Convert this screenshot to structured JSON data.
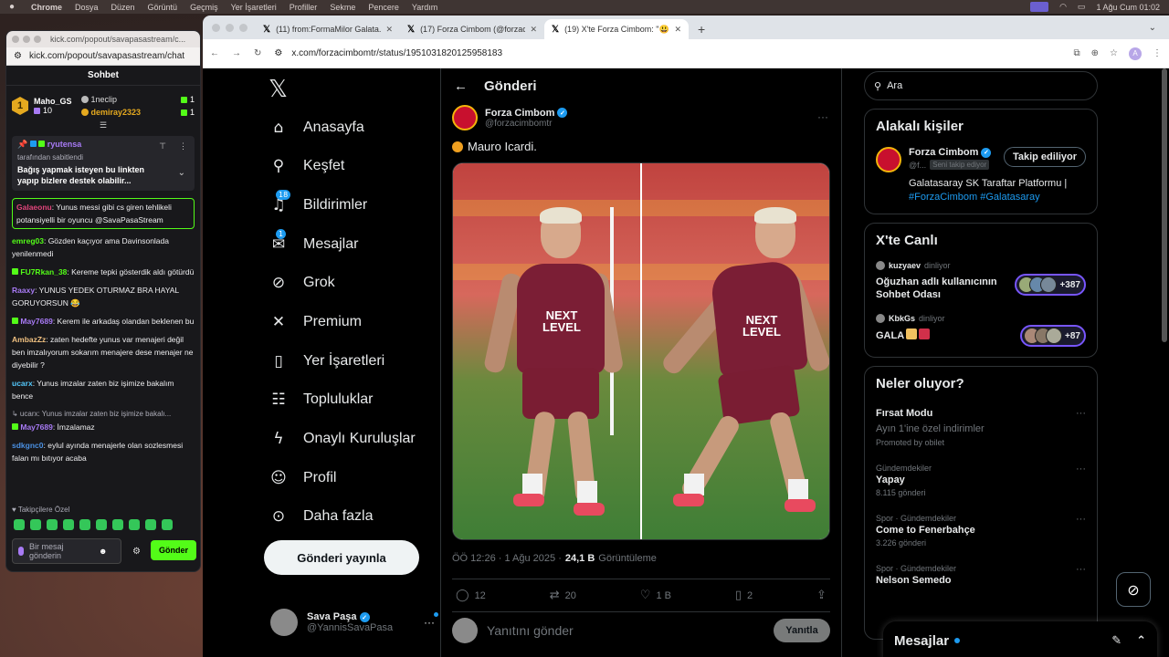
{
  "menubar": {
    "app": "Chrome",
    "items": [
      "Dosya",
      "Düzen",
      "Görüntü",
      "Geçmiş",
      "Yer İşaretleri",
      "Profiller",
      "Sekme",
      "Pencere",
      "Yardım"
    ],
    "clock": "1 Ağu Cum  01:02"
  },
  "kick": {
    "title_url": "kick.com/popout/savapasastream/c...",
    "url": "kick.com/popout/savapasastream/chat",
    "header": "Sohbet",
    "leader": {
      "name": "Maho_GS",
      "points": "10",
      "rank": "1"
    },
    "leader2": {
      "name": "1neclip",
      "points": "1"
    },
    "leader3": {
      "name": "demiray2323",
      "points": "1"
    },
    "pinned": {
      "user": "ryutensa",
      "subtitle": "tarafından sabitlendi",
      "message": "Bağış yapmak isteyen bu linkten yapıp bizlere destek olabilir..."
    },
    "messages": [
      {
        "user": "Galaeonu",
        "color": "#e0457b",
        "text": ": Yunus messi gibi cs giren tehlikeli potansiyelli bir oyuncu @SavaPasaStream",
        "highlight": true
      },
      {
        "user": "emreg03",
        "color": "#53fc18",
        "text": ": Gözden kaçıyor ama Davinsonlada yenilenmedi"
      },
      {
        "user": "FU7Rkan_38",
        "color": "#53fc18",
        "text": ": Kereme tepki gösterdik aldı götürdü",
        "badge": true
      },
      {
        "user": "Raaxy",
        "color": "#a77af4",
        "text": ": YUNUS YEDEK OTURMAZ BRA HAYAL GORUYORSUN 😂"
      },
      {
        "user": "May7689",
        "color": "#a77af4",
        "text": ": Kerem ile arkadaş olandan beklenen bu",
        "badge": true
      },
      {
        "user": "AmbazZz",
        "color": "#f0c080",
        "text": ": zaten hedefte yunus var menajeri değil ben imzalıyorum sokarım menajere dese menajer ne diyebilir ?"
      },
      {
        "user": "ucarx",
        "color": "#53c8fc",
        "text": ": Yunus imzalar zaten biz işimize bakalım bence"
      }
    ],
    "reply_ref": "↳ ucarx: Yunus imzalar zaten biz işimize bakalı...",
    "reply_msg": {
      "user": "May7689",
      "color": "#a77af4",
      "text": ": İmzalamaz"
    },
    "last_msg": {
      "user": "sdkgnc0",
      "color": "#4a90e2",
      "text": ": eylul ayında menajerle olan sozlesmesi falan mı bıtıyor acaba"
    },
    "emotes_label": "Takipçilere Özel",
    "input_placeholder": "Bir mesaj gönderin",
    "send": "Gönder"
  },
  "chrome": {
    "tabs": [
      {
        "title": "(11) from:FormaMilor Galata..."
      },
      {
        "title": "(17) Forza Cimbom (@forzaci..."
      },
      {
        "title": "(19) X'te Forza Cimbom: \"😃"
      }
    ],
    "url": "x.com/forzacimbomtr/status/1951031820125958183",
    "profile_letter": "A"
  },
  "nav": {
    "items": [
      {
        "label": "Anasayfa",
        "icon": "home-icon"
      },
      {
        "label": "Keşfet",
        "icon": "search-icon"
      },
      {
        "label": "Bildirimler",
        "icon": "bell-icon",
        "count": "18"
      },
      {
        "label": "Mesajlar",
        "icon": "mail-icon",
        "count": "1"
      },
      {
        "label": "Grok",
        "icon": "grok-icon"
      },
      {
        "label": "Premium",
        "icon": "x-icon"
      },
      {
        "label": "Yer İşaretleri",
        "icon": "bookmark-icon"
      },
      {
        "label": "Topluluklar",
        "icon": "people-icon"
      },
      {
        "label": "Onaylı Kuruluşlar",
        "icon": "bolt-icon"
      },
      {
        "label": "Profil",
        "icon": "person-icon"
      },
      {
        "label": "Daha fazla",
        "icon": "more-icon"
      }
    ],
    "post_button": "Gönderi yayınla",
    "me": {
      "name": "Sava Paşa",
      "handle": "@YannisSavaPasa"
    }
  },
  "post": {
    "header": "Gönderi",
    "author": "Forza Cimbom",
    "handle": "@forzacimbomtr",
    "text": "Mauro Icardi.",
    "time": "ÖÖ 12:26 · 1 Ağu 2025 · ",
    "views": "24,1 B",
    "views_label": "Görüntüleme",
    "replies": "12",
    "reposts": "20",
    "likes": "1 B",
    "bookmarks": "2",
    "reply_placeholder": "Yanıtını gönder",
    "reply_button": "Yanıtla",
    "jersey_text": "NEXT LEVEL"
  },
  "side": {
    "search_placeholder": "Ara",
    "related_title": "Alakalı kişiler",
    "related": {
      "name": "Forza Cimbom",
      "handle": "@f...",
      "follows_you": "Seni takip ediyor",
      "button": "Takip ediliyor",
      "bio": "Galatasaray SK Taraftar Platformu |",
      "tags": "#ForzaCimbom #Galatasaray"
    },
    "live_title": "X'te Canlı",
    "live": [
      {
        "host": "kuzyaev",
        "verb": "dinliyor",
        "title": "Oğuzhan adlı kullanıcının Sohbet Odası",
        "count": "+387"
      },
      {
        "host": "KbkGs",
        "verb": "dinliyor",
        "title": "GALA",
        "count": "+87"
      }
    ],
    "trends_title": "Neler oluyor?",
    "trends": [
      {
        "ctx": "",
        "name": "Fırsat Modu",
        "sub": "Ayın 1'ine özel indirimler",
        "promo": "Promoted by obilet"
      },
      {
        "ctx": "Gündemdekiler",
        "name": "Yapay",
        "count": "8.115 gönderi"
      },
      {
        "ctx": "Spor · Gündemdekiler",
        "name": "Come to Fenerbahçe",
        "count": "3.226 gönderi"
      },
      {
        "ctx": "Spor · Gündemdekiler",
        "name": "Nelson Semedo",
        "count": ""
      }
    ],
    "messages_dock": "Mesajlar"
  },
  "colors": {
    "x_blue": "#1d9bf0",
    "kick_green": "#53fc18",
    "gs_red": "#c8102e"
  }
}
